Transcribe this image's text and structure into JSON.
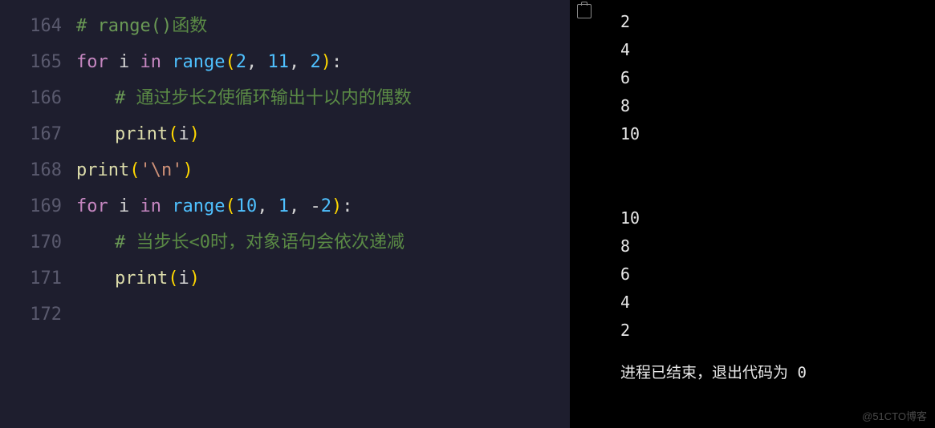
{
  "editor": {
    "lines": [
      {
        "num": "164",
        "tokens": [
          {
            "cls": "tok-comment",
            "text": "# range()"
          },
          {
            "cls": "tok-comment-cn",
            "text": "函数"
          }
        ]
      },
      {
        "num": "165",
        "tokens": [
          {
            "cls": "tok-keyword",
            "text": "for"
          },
          {
            "cls": "tok-var",
            "text": " i "
          },
          {
            "cls": "tok-keyword",
            "text": "in"
          },
          {
            "cls": "tok-var",
            "text": " "
          },
          {
            "cls": "tok-func",
            "text": "range"
          },
          {
            "cls": "tok-punct",
            "text": "("
          },
          {
            "cls": "tok-num",
            "text": "2"
          },
          {
            "cls": "tok-var",
            "text": ", "
          },
          {
            "cls": "tok-num",
            "text": "11"
          },
          {
            "cls": "tok-var",
            "text": ", "
          },
          {
            "cls": "tok-num",
            "text": "2"
          },
          {
            "cls": "tok-punct",
            "text": ")"
          },
          {
            "cls": "tok-var",
            "text": ":"
          }
        ]
      },
      {
        "num": "166",
        "indent": 1,
        "tokens": [
          {
            "cls": "tok-comment",
            "text": "# "
          },
          {
            "cls": "tok-comment-cn",
            "text": "通过步长2使循环输出十以内的偶数"
          }
        ]
      },
      {
        "num": "167",
        "indent": 1,
        "tokens": [
          {
            "cls": "tok-call",
            "text": "print"
          },
          {
            "cls": "tok-punct",
            "text": "("
          },
          {
            "cls": "tok-var",
            "text": "i"
          },
          {
            "cls": "tok-punct",
            "text": ")"
          }
        ]
      },
      {
        "num": "168",
        "tokens": [
          {
            "cls": "tok-call",
            "text": "print"
          },
          {
            "cls": "tok-punct",
            "text": "("
          },
          {
            "cls": "tok-str",
            "text": "'\\n'"
          },
          {
            "cls": "tok-punct",
            "text": ")"
          }
        ]
      },
      {
        "num": "169",
        "tokens": [
          {
            "cls": "tok-keyword",
            "text": "for"
          },
          {
            "cls": "tok-var",
            "text": " i "
          },
          {
            "cls": "tok-keyword",
            "text": "in"
          },
          {
            "cls": "tok-var",
            "text": " "
          },
          {
            "cls": "tok-func",
            "text": "range"
          },
          {
            "cls": "tok-punct",
            "text": "("
          },
          {
            "cls": "tok-num",
            "text": "10"
          },
          {
            "cls": "tok-var",
            "text": ", "
          },
          {
            "cls": "tok-num",
            "text": "1"
          },
          {
            "cls": "tok-var",
            "text": ", "
          },
          {
            "cls": "tok-op",
            "text": "-"
          },
          {
            "cls": "tok-num",
            "text": "2"
          },
          {
            "cls": "tok-punct",
            "text": ")"
          },
          {
            "cls": "tok-var",
            "text": ":"
          }
        ]
      },
      {
        "num": "170",
        "indent": 1,
        "tokens": [
          {
            "cls": "tok-comment",
            "text": "# "
          },
          {
            "cls": "tok-comment-cn",
            "text": "当步长<0时，对象语句会依次递减"
          }
        ]
      },
      {
        "num": "171",
        "indent": 1,
        "tokens": [
          {
            "cls": "tok-call",
            "text": "print"
          },
          {
            "cls": "tok-punct",
            "text": "("
          },
          {
            "cls": "tok-var",
            "text": "i"
          },
          {
            "cls": "tok-punct",
            "text": ")"
          }
        ]
      },
      {
        "num": "172",
        "tokens": []
      }
    ]
  },
  "output": {
    "lines1": [
      "2",
      "4",
      "6",
      "8",
      "10"
    ],
    "lines2": [
      "10",
      "8",
      "6",
      "4",
      "2"
    ],
    "exit_message": "进程已结束，退出代码为 0"
  },
  "watermark": "@51CTO博客"
}
